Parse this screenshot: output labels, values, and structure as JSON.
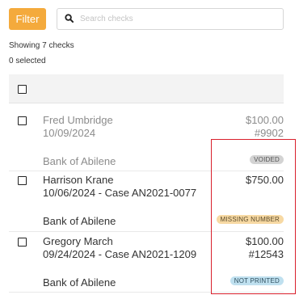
{
  "toolbar": {
    "filter_label": "Filter",
    "search_placeholder": "Search checks",
    "search_value": ""
  },
  "summary": {
    "showing": "Showing 7 checks",
    "selected": "0 selected"
  },
  "rows": [
    {
      "payee": "Fred Umbridge",
      "detail": "10/09/2024",
      "amount": "$100.00",
      "check_number": "#9902",
      "bank": "Bank of Abilene",
      "status": "VOIDED",
      "status_bg": "#d3d3d3",
      "status_fg": "#555555"
    },
    {
      "payee": "Harrison Krane",
      "detail": "10/06/2024 - Case AN2021-0077",
      "amount": "$750.00",
      "check_number": "",
      "bank": "Bank of Abilene",
      "status": "MISSING NUMBER",
      "status_bg": "#f7d9a3",
      "status_fg": "#5a4a2a"
    },
    {
      "payee": "Gregory March",
      "detail": "09/24/2024 - Case AN2021-1209",
      "amount": "$100.00",
      "check_number": "#12543",
      "bank": "Bank of Abilene",
      "status": "NOT PRINTED",
      "status_bg": "#bfe0ef",
      "status_fg": "#2f4f5f"
    }
  ],
  "colors": {
    "accent": "#f4aa3c",
    "highlight": "#d9202c"
  }
}
